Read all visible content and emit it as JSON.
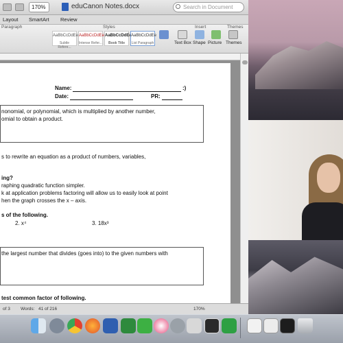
{
  "window": {
    "zoom": "170%",
    "title": "eduCanon Notes.docx",
    "search_placeholder": "Search in Document"
  },
  "ribbon_tabs": [
    "Layout",
    "SmartArt",
    "Review"
  ],
  "ribbon": {
    "group_paragraph": "Paragraph",
    "group_styles": "Styles",
    "group_insert": "Insert",
    "group_themes": "Themes",
    "styles": [
      {
        "sample": "AaBbCcDdEe",
        "name": "Subtle Refere..."
      },
      {
        "sample": "AaBbCcDdEe",
        "name": "Intense Refer..."
      },
      {
        "sample": "AaBbCcDdEe",
        "name": "Book Title"
      },
      {
        "sample": "AaBbCcDdEe",
        "name": "List Paragraph"
      }
    ],
    "insert_items": [
      {
        "label": "Text Box",
        "icon": "text-box-icon"
      },
      {
        "label": "Shape",
        "icon": "shape-icon"
      },
      {
        "label": "Picture",
        "icon": "picture-icon"
      },
      {
        "label": "Themes",
        "icon": "themes-icon"
      }
    ]
  },
  "document": {
    "name_label": "Name:",
    "name_suffix": ":)",
    "date_label": "Date:",
    "pr_label": "PR:",
    "def1_line1": "nonomial, or polynomial, which is multiplied by another number,",
    "def1_line2": "omial to obtain a product.",
    "factoring_line1": "s to rewrite an equation as a product of numbers, variables,",
    "why_heading": "ing?",
    "why_line1": "raphing quadratic function simpler.",
    "why_line2": "k at application problems factoring will allow us to easily look at point",
    "why_line3": "hen the graph crosses the x – axis.",
    "factors_heading": "s of the following.",
    "problem2": "2. x⁴",
    "problem3": "3. 18x³",
    "gcf_def": "the largest number that divides (goes into) to the given numbers with",
    "gcf_heading": "test common factor of following."
  },
  "status": {
    "pages": "of 3",
    "words_label": "Words:",
    "words_value": "41 of 216",
    "zoom": "170%"
  },
  "dock_apps": [
    "finder-icon",
    "launchpad-icon",
    "rocket-icon",
    "chrome-icon",
    "firefox-icon",
    "word-icon",
    "excel-icon",
    "facetime-icon",
    "itunes-icon",
    "system-preferences-icon",
    "preview-icon",
    "screen-recorder-icon",
    "camtasia-icon",
    "documents-icon",
    "downloads-icon",
    "terminal-icon",
    "trash-icon"
  ]
}
